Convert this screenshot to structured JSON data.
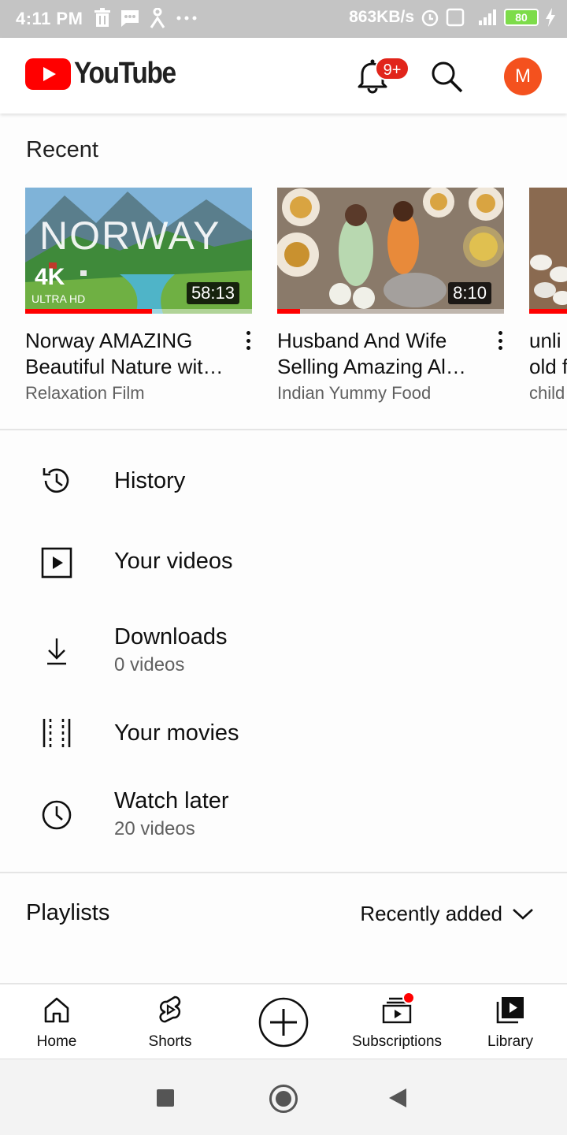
{
  "status_bar": {
    "time": "4:11 PM",
    "icons_left": [
      "trash-icon",
      "message-icon",
      "accessibility-icon",
      "more-icon"
    ],
    "speed": "863KB/s",
    "battery": "80"
  },
  "header": {
    "app_name": "YouTube",
    "notification_badge": "9+",
    "avatar_letter": "M",
    "brand_color": "#ff0000"
  },
  "recent": {
    "title": "Recent",
    "videos": [
      {
        "title_line1": "Norway AMAZING",
        "title_line2": "Beautiful Nature wit…",
        "channel": "Relaxation Film",
        "duration": "58:13",
        "progress": 0.56,
        "thumb_text": "NORWAY",
        "thumb_badge": "4K",
        "thumb_sub": "ULTRA HD"
      },
      {
        "title_line1": "Husband And Wife",
        "title_line2": "Selling Amazing Al…",
        "channel": "Indian Yummy Food",
        "duration": "8:10",
        "progress": 0.1
      },
      {
        "title_line1": "unli",
        "title_line2": "old f",
        "channel": "child",
        "progress": 0.6
      }
    ]
  },
  "library": {
    "items": [
      {
        "label": "History",
        "icon": "history-icon"
      },
      {
        "label": "Your videos",
        "icon": "play-square-icon"
      },
      {
        "label": "Downloads",
        "sub": "0 videos",
        "icon": "download-icon"
      },
      {
        "label": "Your movies",
        "icon": "film-icon"
      },
      {
        "label": "Watch later",
        "sub": "20 videos",
        "icon": "clock-icon"
      }
    ]
  },
  "playlists": {
    "title": "Playlists",
    "sort_label": "Recently added"
  },
  "bottom_nav": {
    "items": [
      {
        "label": "Home",
        "icon": "home-icon"
      },
      {
        "label": "Shorts",
        "icon": "shorts-icon"
      },
      {
        "label": "",
        "icon": "create-icon"
      },
      {
        "label": "Subscriptions",
        "icon": "subscriptions-icon"
      },
      {
        "label": "Library",
        "icon": "library-icon"
      }
    ]
  }
}
